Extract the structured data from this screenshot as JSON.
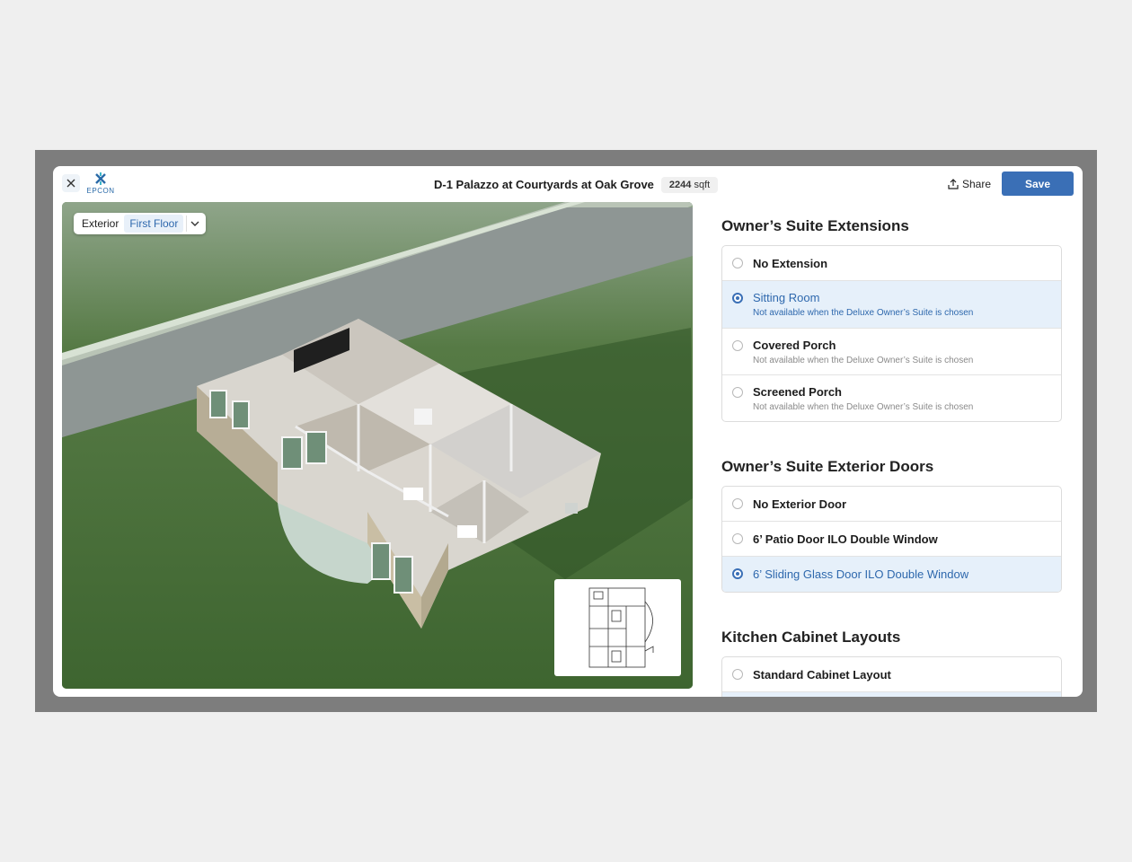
{
  "header": {
    "logo_text": "EPCON",
    "title": "D-1 Palazzo at Courtyards at Oak Grove",
    "sqft_value": "2244",
    "sqft_unit": "sqft",
    "share_label": "Share",
    "save_label": "Save"
  },
  "viewer": {
    "exterior_label": "Exterior",
    "floor_label": "First Floor"
  },
  "sections": [
    {
      "title": "Owner’s Suite Extensions",
      "options": [
        {
          "label": "No Extension",
          "note": "",
          "selected": false
        },
        {
          "label": "Sitting Room",
          "note": "Not available when the Deluxe Owner’s Suite is chosen",
          "selected": true
        },
        {
          "label": "Covered Porch",
          "note": "Not available when the Deluxe Owner’s Suite is chosen",
          "selected": false
        },
        {
          "label": "Screened Porch",
          "note": "Not available when the Deluxe Owner’s Suite is chosen",
          "selected": false
        }
      ]
    },
    {
      "title": "Owner’s Suite Exterior Doors",
      "options": [
        {
          "label": "No Exterior Door",
          "selected": false
        },
        {
          "label": "6’ Patio Door ILO Double Window",
          "selected": false
        },
        {
          "label": "6’ Sliding Glass Door ILO Double Window",
          "selected": true
        }
      ]
    },
    {
      "title": "Kitchen Cabinet Layouts",
      "options": [
        {
          "label": "Standard Cabinet Layout",
          "selected": false
        }
      ]
    }
  ],
  "colors": {
    "accent": "#3a6fb6",
    "selected_bg": "#e6f0fa",
    "backdrop": "#7d7d7d"
  }
}
